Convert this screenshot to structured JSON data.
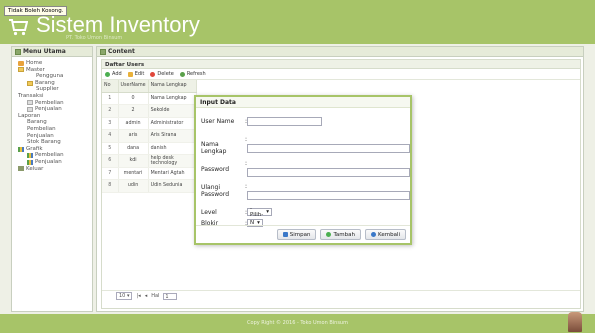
{
  "tooltip": "Tidak Boleh Kosong.",
  "app": {
    "title": "Sistem Inventory",
    "subtitle": "PT. Toko Umon Binsum"
  },
  "sidebar": {
    "title": "Menu Utama",
    "tree": [
      {
        "label": "Home",
        "icon": "home-icon"
      },
      {
        "label": "Master",
        "icon": "folder-icon"
      },
      {
        "label": "Pengguna",
        "icon": ""
      },
      {
        "label": "Barang",
        "icon": "folder-icon"
      },
      {
        "label": "Supplier",
        "icon": ""
      },
      {
        "label": "Transaksi",
        "icon": ""
      },
      {
        "label": "Pembelian",
        "icon": "doc-icon"
      },
      {
        "label": "Penjualan",
        "icon": "doc-icon"
      },
      {
        "label": "Laporan",
        "icon": ""
      },
      {
        "label": "Barang",
        "icon": ""
      },
      {
        "label": "Pembelian",
        "icon": ""
      },
      {
        "label": "Penjualan",
        "icon": ""
      },
      {
        "label": "Stok Barang",
        "icon": ""
      },
      {
        "label": "Grafik",
        "icon": "chart-icon"
      },
      {
        "label": "Pembelian",
        "icon": "chart-icon"
      },
      {
        "label": "Penjualan",
        "icon": "chart-icon"
      },
      {
        "label": "Keluar",
        "icon": "exit-icon"
      }
    ]
  },
  "content": {
    "title": "Content",
    "grid_title": "Daftar Users",
    "toolbar": {
      "add": "Add",
      "edit": "Edit",
      "delete": "Delete",
      "refresh": "Refresh"
    },
    "columns": [
      "No",
      "UserName",
      "Nama Lengkap"
    ],
    "rows": [
      [
        "1",
        "0",
        "Nama Lengkap"
      ],
      [
        "2",
        "2",
        "Sekolde"
      ],
      [
        "3",
        "admin",
        "Administrator"
      ],
      [
        "4",
        "aris",
        "Aris Sirana"
      ],
      [
        "5",
        "dana",
        "danish"
      ],
      [
        "6",
        "kdi",
        "help desk technology"
      ],
      [
        "7",
        "mentari",
        "Mentari Agtah"
      ],
      [
        "8",
        "udin",
        "Udin Sedunia"
      ]
    ],
    "pager": {
      "page_size": "10",
      "hal_label": "Hal",
      "page": "1"
    }
  },
  "dialog": {
    "title": "Input Data",
    "fields": {
      "username": "User Name",
      "nama": "Nama Lengkap",
      "password": "Password",
      "ulangi": "Ulangi Password",
      "level": "Level",
      "blokir": "Blokir"
    },
    "level_value": "-Pilih-",
    "blokir_value": "N",
    "buttons": {
      "simpan": "Simpan",
      "tambah": "Tambah",
      "kembali": "Kembali"
    }
  },
  "footer": {
    "text": "Copy Right © 2016 - Toko Umon Binsum"
  },
  "colors": {
    "header": "#a7c468",
    "accent": "#a7c468"
  }
}
